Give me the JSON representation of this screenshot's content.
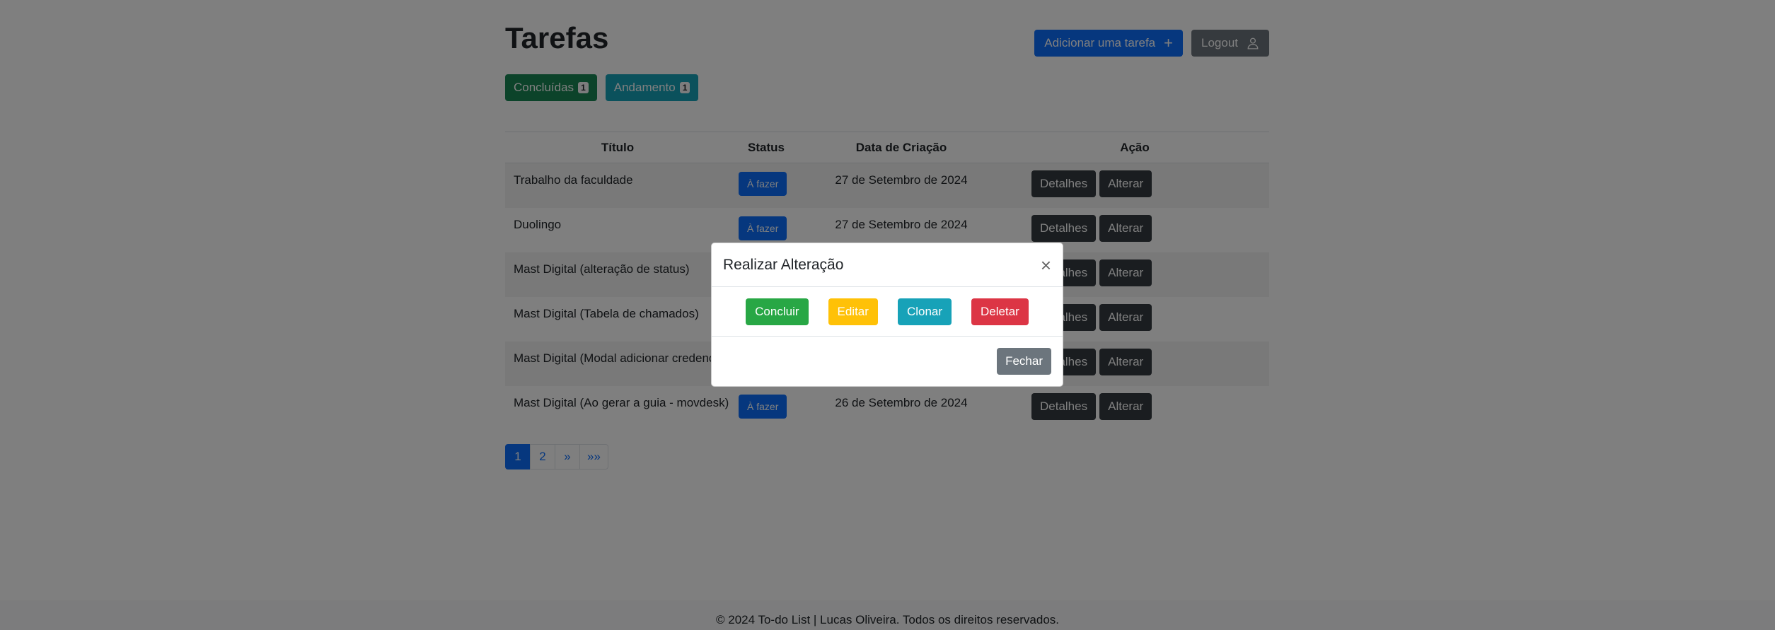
{
  "page": {
    "title": "Tarefas",
    "add_task_label": "Adicionar uma tarefa",
    "logout_label": "Logout",
    "filters": [
      {
        "label": "Concluídas",
        "count": "1"
      },
      {
        "label": "Andamento",
        "count": "1"
      }
    ]
  },
  "table": {
    "headers": [
      "Título",
      "Status",
      "Data de Criação",
      "Ação"
    ],
    "rows": [
      {
        "title": "Trabalho da faculdade",
        "status": "À fazer",
        "date": "27 de Setembro de 2024",
        "details": "Detalhes",
        "alter": "Alterar"
      },
      {
        "title": "Duolingo",
        "status": "À fazer",
        "date": "27 de Setembro de 2024",
        "details": "Detalhes",
        "alter": "Alterar"
      },
      {
        "title": "Mast Digital (alteração de status)",
        "status": "",
        "date": "",
        "details": "Detalhes",
        "alter": "Alterar"
      },
      {
        "title": "Mast Digital (Tabela de chamados)",
        "status": "",
        "date": "",
        "details": "Detalhes",
        "alter": "Alterar"
      },
      {
        "title": "Mast Digital (Modal adicionar credencia",
        "status": "",
        "date": "",
        "details": "Detalhes",
        "alter": "Alterar"
      },
      {
        "title": "Mast Digital (Ao gerar a guia - movdesk)",
        "status": "À fazer",
        "date": "26 de Setembro de 2024",
        "details": "Detalhes",
        "alter": "Alterar"
      }
    ]
  },
  "pagination": [
    "1",
    "2",
    "»",
    "»»"
  ],
  "footer": "© 2024 To-do List | Lucas Oliveira. Todos os direitos reservados.",
  "modal": {
    "title": "Realizar Alteração",
    "close": "×",
    "actions": [
      "Concluir",
      "Editar",
      "Clonar",
      "Deletar"
    ],
    "close_button": "Fechar"
  },
  "colors": {
    "primary": "#0d6efd",
    "success": "#28a745",
    "warning": "#ffc107",
    "info": "#17a2b8",
    "danger": "#dc3545",
    "secondary": "#6c757d",
    "dark": "#343a40"
  },
  "icons": {
    "add": "plus-icon",
    "logout": "user-icon",
    "close": "close-icon"
  }
}
